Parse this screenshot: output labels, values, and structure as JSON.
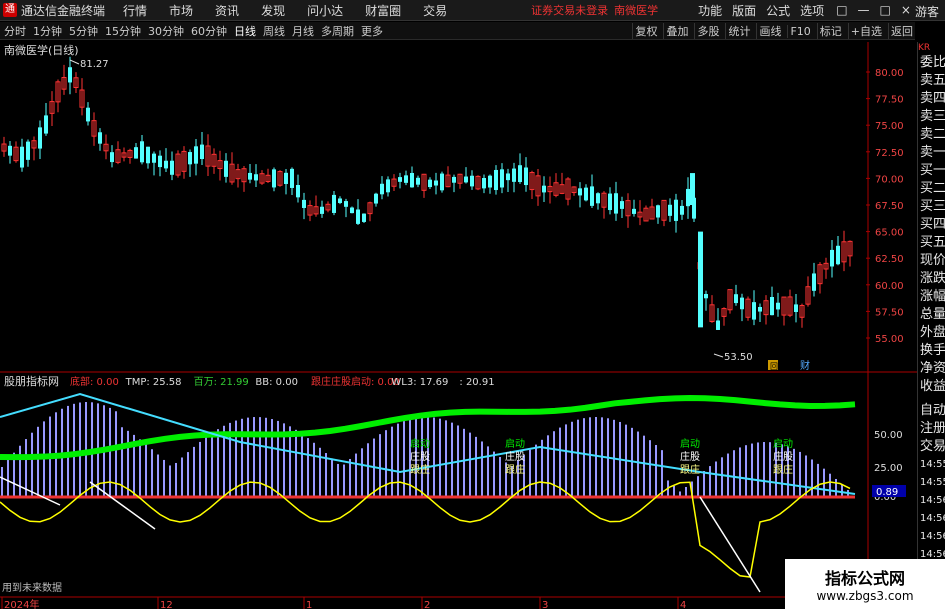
{
  "app": {
    "title": "通达信金融终端",
    "menu": [
      "行情",
      "市场",
      "资讯",
      "发现",
      "问小达",
      "财富圈",
      "交易"
    ],
    "status_text": "证券交易未登录",
    "stock_name": "南微医学",
    "right_menu": [
      "功能",
      "版面",
      "公式",
      "选项"
    ],
    "guest": "游客",
    "window_icons": [
      "□",
      "—",
      "□",
      "×"
    ]
  },
  "periods": [
    "分时",
    "1分钟",
    "5分钟",
    "15分钟",
    "30分钟",
    "60分钟",
    "日线",
    "周线",
    "月线",
    "多周期",
    "更多"
  ],
  "active_period": "日线",
  "toolbar_right": [
    "复权",
    "叠加",
    "多股",
    "统计",
    "画线",
    "F10",
    "标记",
    "+自选",
    "返回"
  ],
  "main_chart": {
    "title": "南微医学(日线)",
    "price_labels": [
      "80.00",
      "77.50",
      "75.00",
      "72.50",
      "70.00",
      "67.50",
      "65.00",
      "62.50",
      "60.00",
      "57.50",
      "55.00"
    ],
    "high_marker": "81.27",
    "low_marker": "53.50",
    "badges": [
      "回",
      "财"
    ]
  },
  "indicator": {
    "name": "股朋指标网",
    "values": [
      {
        "label": "底部: 0.00",
        "color": "#e33"
      },
      {
        "label": "TMP: 25.58",
        "color": "#ddd"
      },
      {
        "label": "百万: 21.99",
        "color": "#3c3"
      },
      {
        "label": "BB: 0.00",
        "color": "#ddd"
      },
      {
        "label": "跟庄庄股启动: 0.00",
        "color": "#e33"
      },
      {
        "label": "WL3: 17.69",
        "color": "#ddd"
      },
      {
        "label": ": 20.91",
        "color": "#ddd"
      }
    ],
    "axis_labels": [
      "50.00",
      "25.00",
      "0.00"
    ],
    "current_value": "0.89",
    "annotations": [
      "启动",
      "庄股",
      "跟庄"
    ]
  },
  "bottom": {
    "note": "用到未来数据",
    "dates": [
      "2024年",
      "12",
      "1",
      "2",
      "3",
      "4"
    ]
  },
  "side_panel": {
    "code": "KR",
    "items": [
      "委比",
      "卖五",
      "卖四",
      "卖三",
      "卖二",
      "卖一",
      "买一",
      "买二",
      "买三",
      "买四",
      "买五",
      "现价",
      "涨跌",
      "涨幅",
      "总量",
      "外盘",
      "换手",
      "净资",
      "收益"
    ],
    "lower_items": [
      "自动",
      "注册",
      "交易"
    ],
    "times": [
      "14:55",
      "14:55",
      "14:56",
      "14:56",
      "14:56",
      "14:56",
      "14:56",
      "14:56"
    ]
  },
  "watermark": {
    "line1": "指标公式网",
    "line2": "www.zbgs3.com"
  },
  "colors": {
    "up": "#ff3333",
    "down": "#54ffff",
    "ma_white": "#ffffff",
    "ma_yellow": "#ffff00",
    "accent_green": "#00ee00"
  }
}
